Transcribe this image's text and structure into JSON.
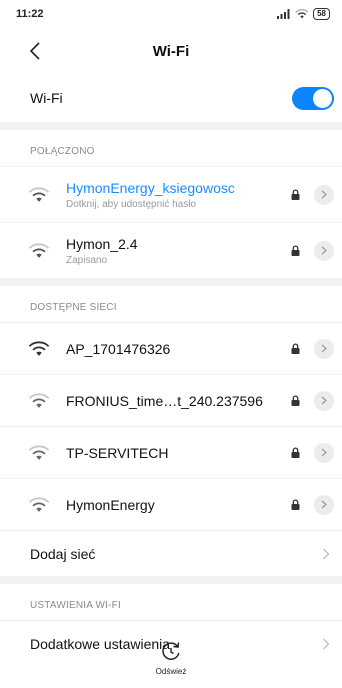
{
  "status_bar": {
    "time": "11:22",
    "battery": "58"
  },
  "header": {
    "title": "Wi-Fi"
  },
  "wifi_toggle": {
    "label": "Wi-Fi",
    "on": true
  },
  "sections": {
    "connected": "POŁĄCZONO",
    "available": "DOSTĘPNE SIECI",
    "settings": "USTAWIENIA WI-FI"
  },
  "connected_networks": [
    {
      "name": "HymonEnergy_ksiegowosc",
      "subtitle": "Dotknij, aby udostępnić hasło",
      "active": true,
      "signal": 3
    },
    {
      "name": "Hymon_2.4",
      "subtitle": "Zapisano",
      "active": false,
      "signal": 3
    }
  ],
  "available_networks": [
    {
      "name": "AP_1701476326",
      "signal": 4
    },
    {
      "name": "FRONIUS_time…t_240.237596",
      "signal": 3
    },
    {
      "name": "TP-SERVITECH",
      "signal": 3
    },
    {
      "name": "HymonEnergy",
      "signal": 3
    }
  ],
  "add_network": {
    "label": "Dodaj sieć"
  },
  "additional_settings": {
    "label": "Dodatkowe ustawienia"
  },
  "footer": {
    "refresh_label": "Odśwież"
  },
  "colors": {
    "accent": "#0d84ff",
    "active_text": "#1a8cff",
    "separator": "#f2f2f2"
  }
}
